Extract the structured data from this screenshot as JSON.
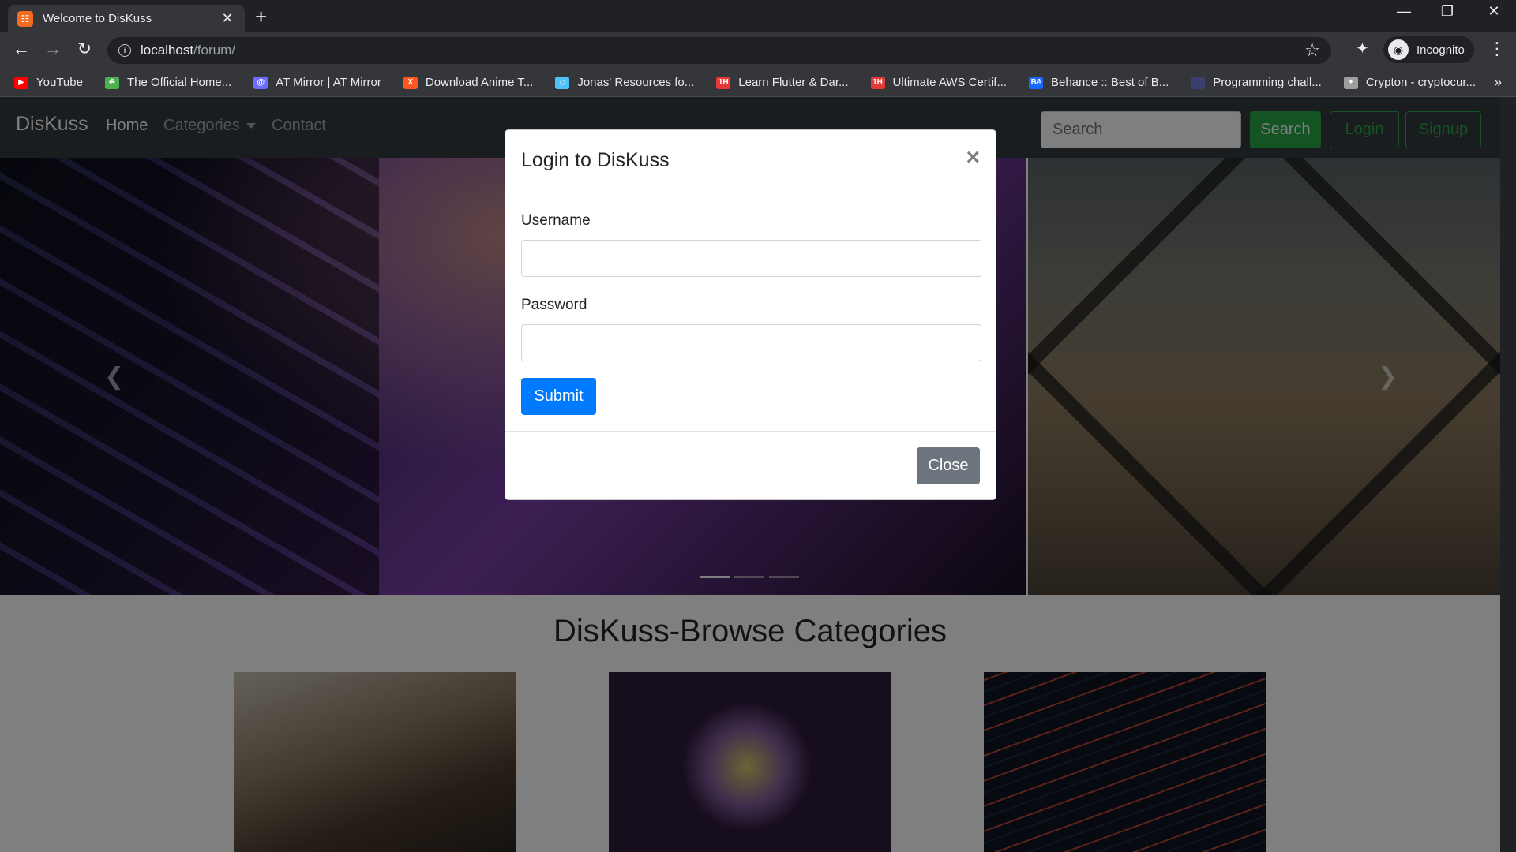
{
  "browser": {
    "tab": {
      "title": "Welcome to DisKuss",
      "favicon": "xampp-icon"
    },
    "address": {
      "host": "localhost",
      "path": "/forum/"
    },
    "profile": {
      "label": "Incognito"
    },
    "bookmarks": [
      {
        "label": "YouTube",
        "icon": "youtube-icon",
        "color": "#ff0000"
      },
      {
        "label": "The Official Home...",
        "icon": "leaf-icon",
        "color": "#4caf50"
      },
      {
        "label": "AT Mirror | AT Mirror",
        "icon": "at-mirror-icon",
        "color": "#6c6cff"
      },
      {
        "label": "Download Anime T...",
        "icon": "x-icon",
        "color": "#ff5722"
      },
      {
        "label": "Jonas' Resources fo...",
        "icon": "diamond-icon",
        "color": "#4fc3f7"
      },
      {
        "label": "Learn Flutter & Dar...",
        "icon": "1h-icon",
        "color": "#e53935"
      },
      {
        "label": "Ultimate AWS Certif...",
        "icon": "1h-icon",
        "color": "#e53935"
      },
      {
        "label": "Behance :: Best of B...",
        "icon": "behance-icon",
        "color": "#1769ff"
      },
      {
        "label": "Programming chall...",
        "icon": "square-icon",
        "color": "#3a3f70"
      },
      {
        "label": "Crypton - cryptocur...",
        "icon": "crypton-icon",
        "color": "#9e9e9e"
      }
    ]
  },
  "site": {
    "brand": "DisKuss",
    "nav": {
      "home": "Home",
      "categories": "Categories",
      "contact": "Contact"
    },
    "search": {
      "placeholder": "Search",
      "button": "Search"
    },
    "login_button": "Login",
    "signup_button": "Signup",
    "section_title": "DisKuss-Browse Categories"
  },
  "modal": {
    "title": "Login to DisKuss",
    "username_label": "Username",
    "password_label": "Password",
    "submit": "Submit",
    "close": "Close"
  },
  "colors": {
    "navbar": "#343a40",
    "success": "#28a745",
    "primary": "#007bff",
    "secondary": "#6c757d"
  }
}
